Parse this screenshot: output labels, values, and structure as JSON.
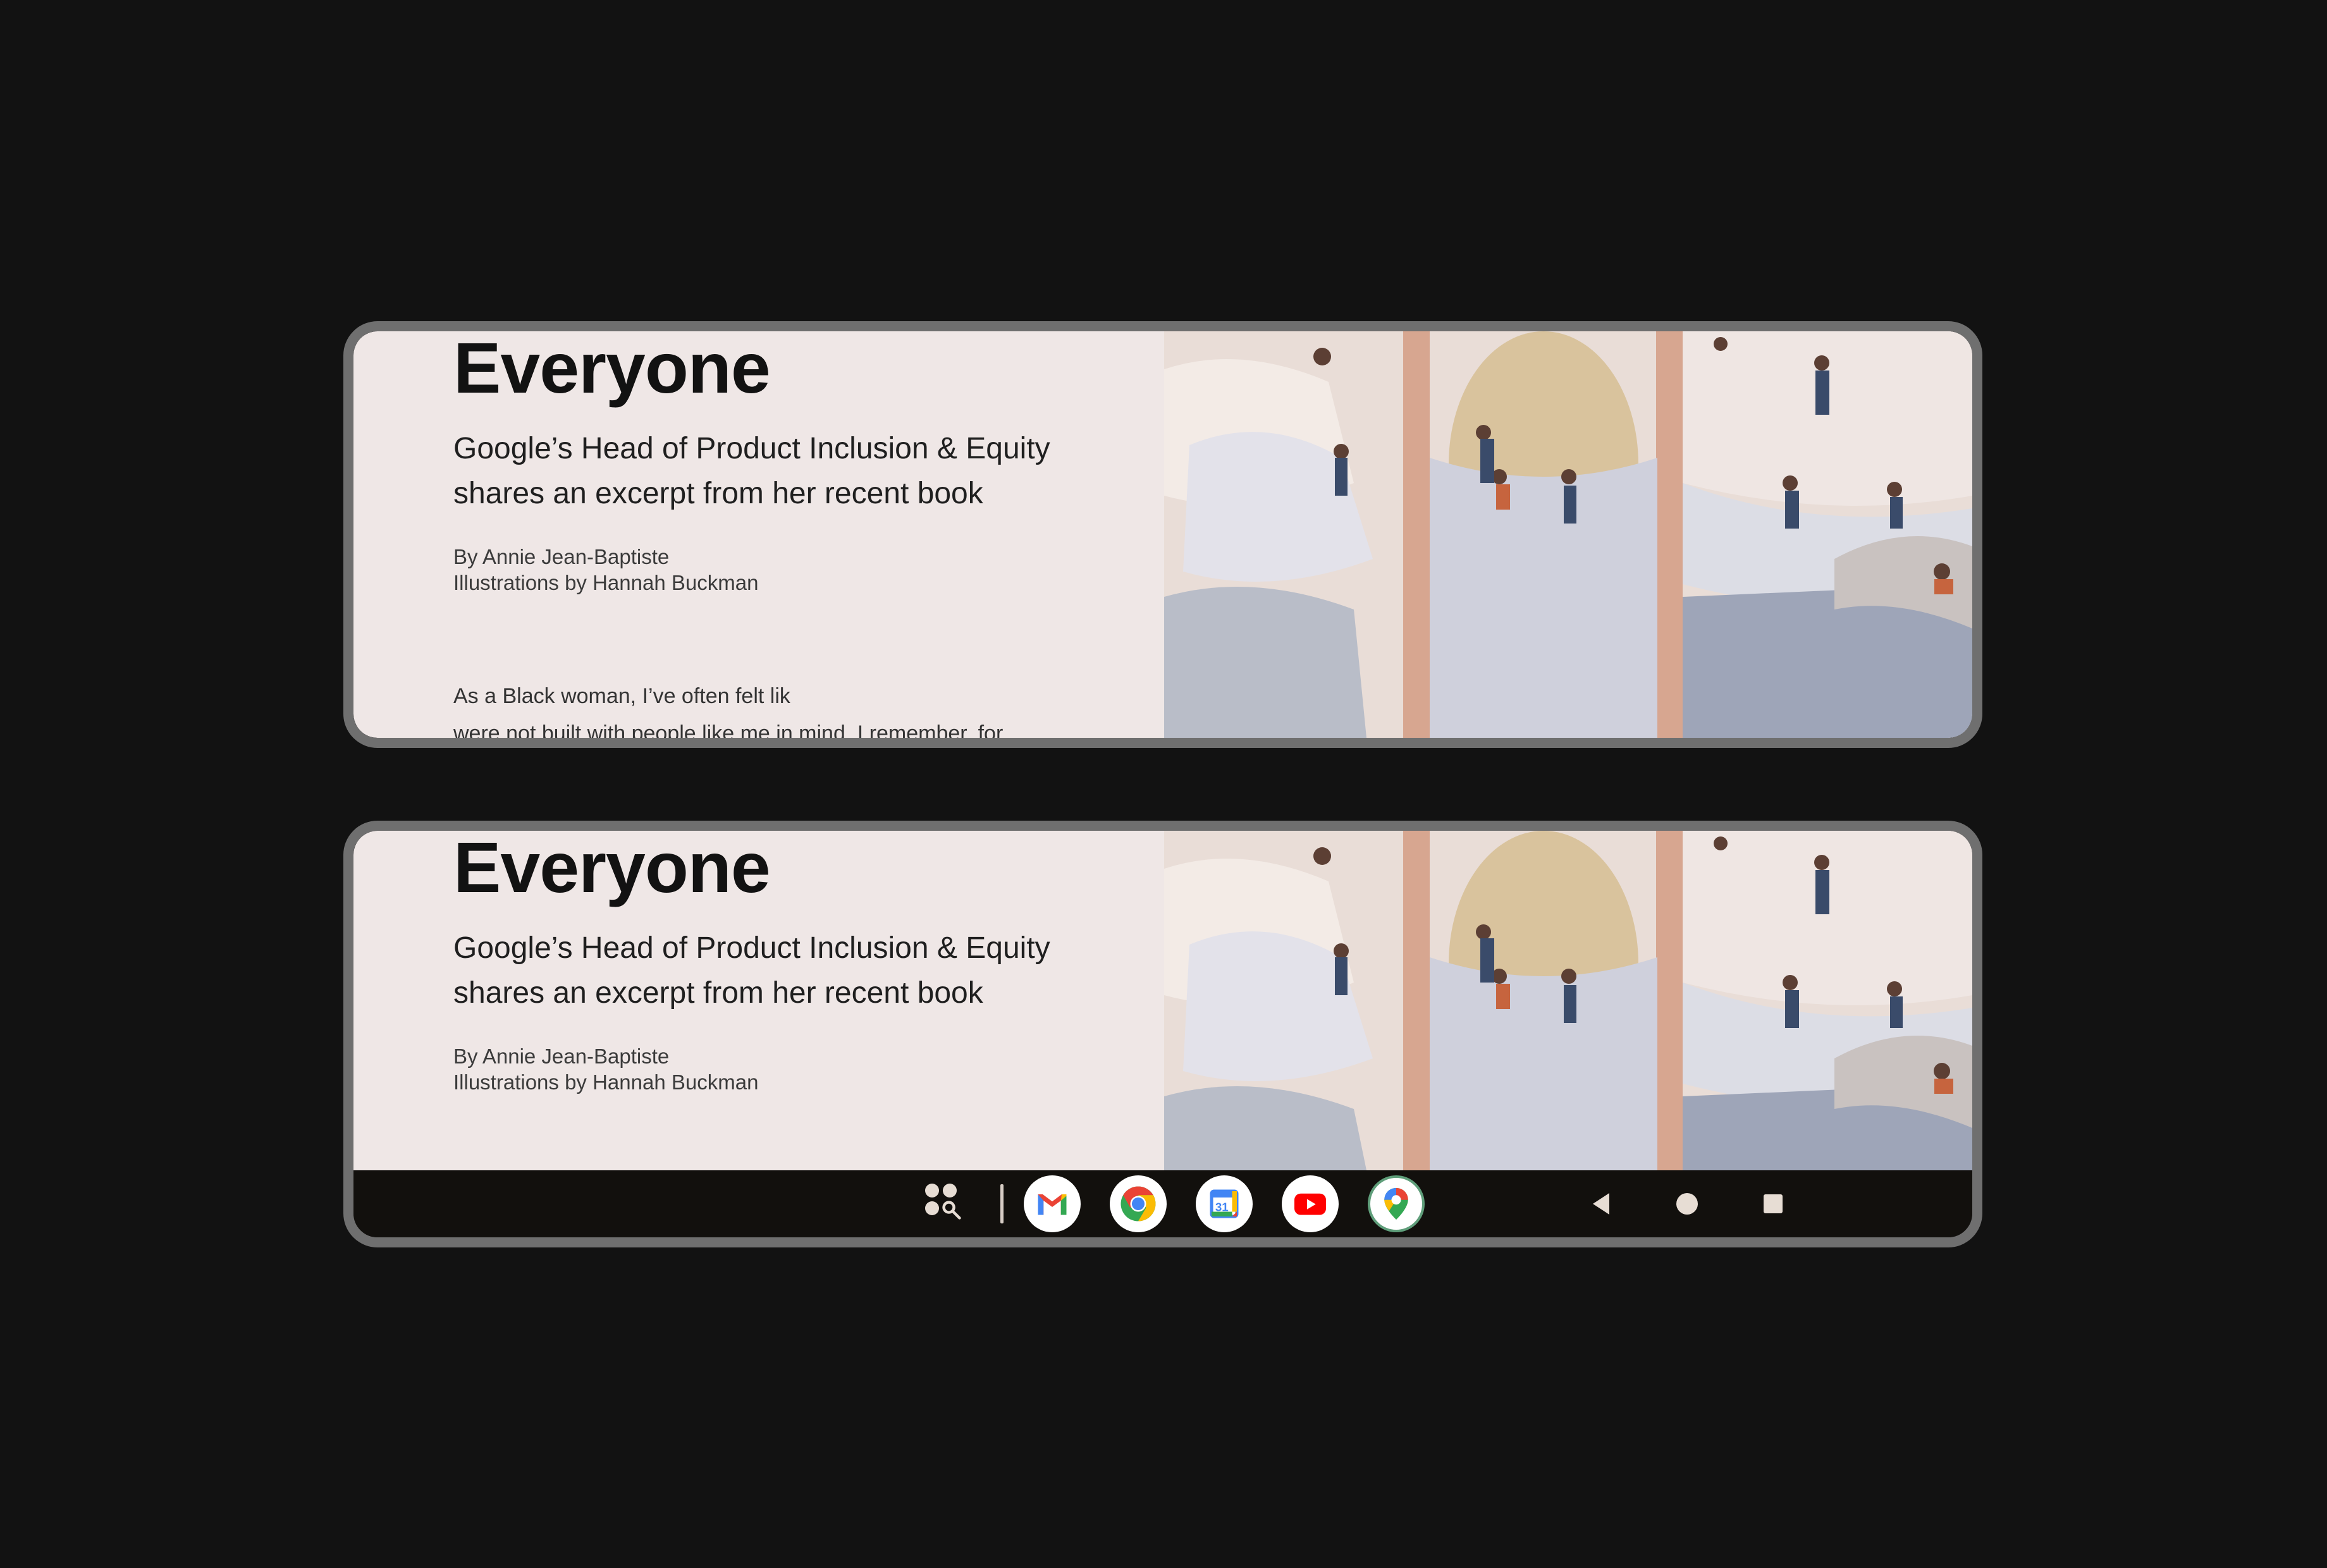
{
  "article": {
    "headline": "Everyone",
    "subhead_line1": "Google’s Head of Product Inclusion & Equity",
    "subhead_line2": "shares an excerpt from her recent book",
    "byline_author": "By Annie Jean-Baptiste",
    "byline_illustrator": "Illustrations by Hannah Buckman",
    "body_line1": "As a Black woman, I’ve often felt lik",
    "body_line2": "were not built with people like me in mind. I remember, for"
  },
  "taskbar": {
    "apps": [
      "gmail-icon",
      "chrome-icon",
      "calendar-icon",
      "youtube-icon",
      "maps-icon",
      "home-icon"
    ],
    "pinned_apps": [
      "gmail-icon",
      "chrome-icon",
      "calendar-icon",
      "youtube-icon",
      "maps-icon"
    ],
    "calendar_day": "31",
    "nav_buttons": [
      "back-button",
      "home-button",
      "recents-button"
    ]
  },
  "colors": {
    "page_background": "#121212",
    "screen_background": "#efe7e6",
    "taskbar_background": "#1a1714",
    "gmail_red": "#ea4335",
    "chrome_green": "#34a853",
    "chrome_yellow": "#fbbc04",
    "chrome_blue": "#4285f4",
    "youtube_red": "#ff0000"
  }
}
